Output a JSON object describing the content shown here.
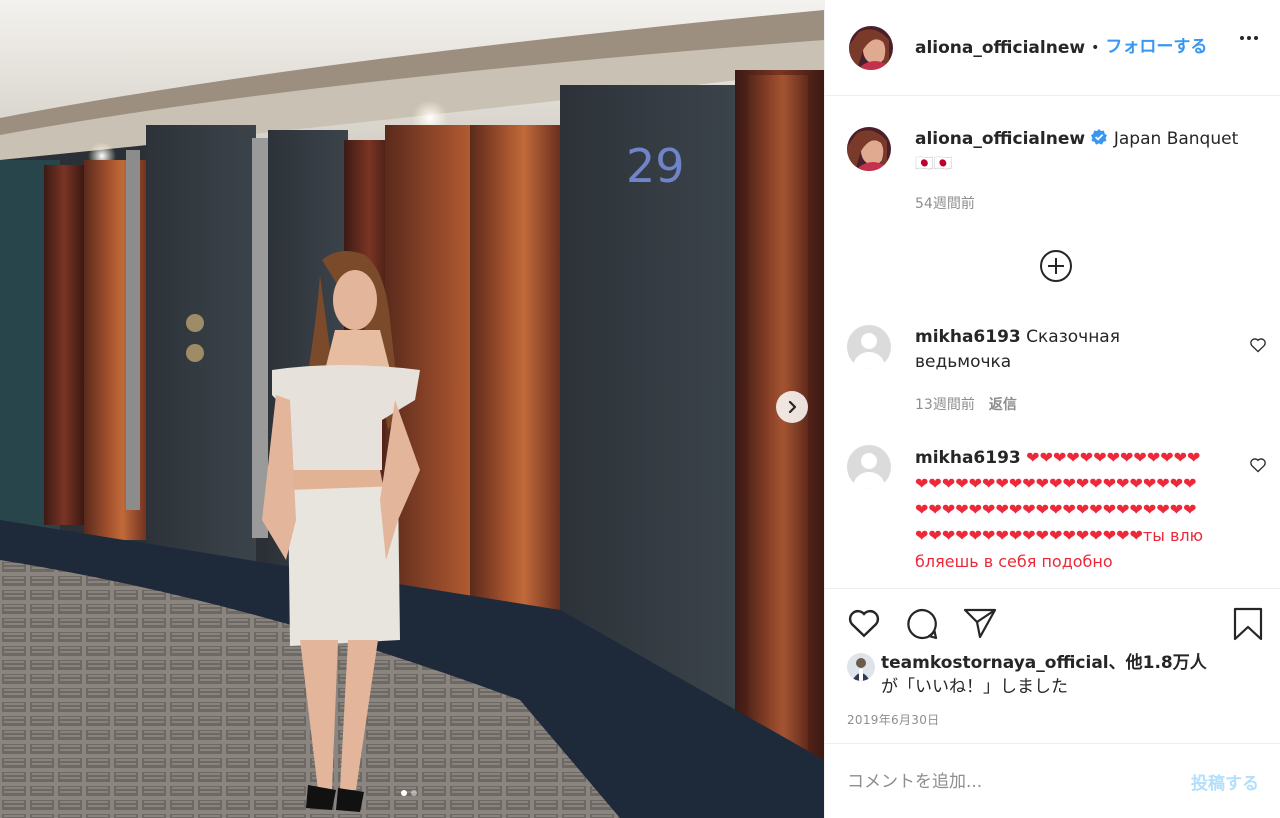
{
  "post": {
    "username": "aliona_officialnew",
    "separator": "•",
    "follow_label": "フォローする",
    "image_room_number": "29",
    "carousel_total": 2,
    "carousel_index": 1
  },
  "caption": {
    "username": "aliona_officialnew",
    "text": "Japan Banquet",
    "flags": "🇯🇵🇯🇵",
    "time": "54週間前"
  },
  "comments": [
    {
      "username": "mikha6193",
      "text": "Сказочная ведьмочка",
      "time": "13週間前",
      "reply_label": "返信"
    },
    {
      "username": "mikha6193",
      "text": "❤❤❤❤❤❤❤❤❤❤❤❤❤❤❤❤❤❤❤❤❤❤❤❤❤❤❤❤❤❤❤❤❤❤❤❤❤❤❤❤❤❤❤❤❤❤❤❤❤❤❤❤❤❤❤❤❤❤❤❤❤❤❤❤❤❤❤❤❤❤❤❤ты влюбляешь в себя подобно"
    }
  ],
  "likes": {
    "user": "teamkostornaya_official",
    "others": "、他1.8万人",
    "suffix": "が「いいね！」しました"
  },
  "date": "2019年6月30日",
  "comment_input": {
    "placeholder": "コメントを追加...",
    "post_label": "投稿する"
  },
  "colors": {
    "accent": "#3897f0",
    "post_disabled": "#b2dffc",
    "muted": "#8e8e8e",
    "heart_red": "#ed2939"
  }
}
